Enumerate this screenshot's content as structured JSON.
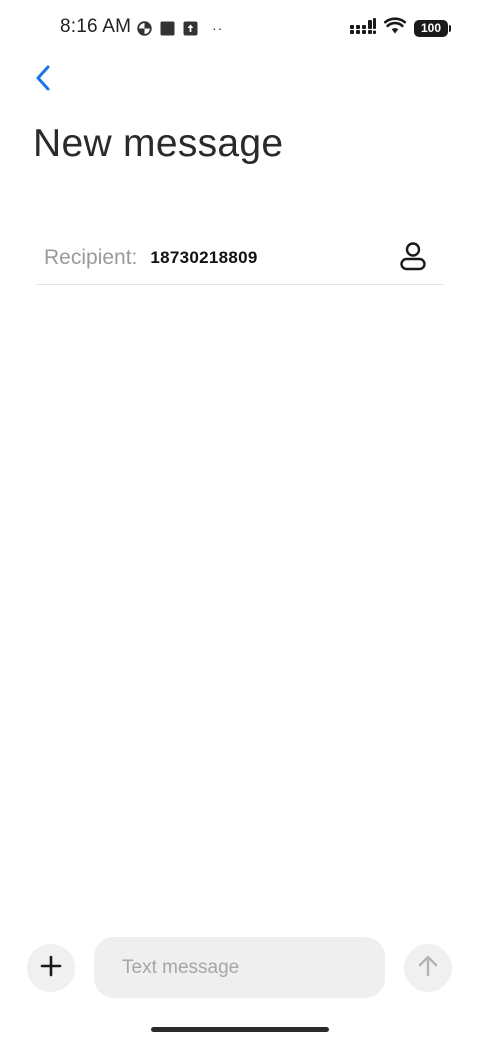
{
  "status_bar": {
    "time": "8:16 AM",
    "left_icons": [
      "data-saver-icon",
      "square-notification-icon",
      "upload-notification-icon"
    ],
    "more_dots": "··",
    "battery_level": "100",
    "right_icons": [
      "cellular-signal-icon",
      "wifi-icon",
      "battery-icon"
    ]
  },
  "header": {
    "back_icon": "chevron-left-icon",
    "title": "New message"
  },
  "recipient": {
    "label": "Recipient:",
    "value": "18730218809",
    "contact_icon": "person-icon"
  },
  "composer": {
    "add_icon": "plus-icon",
    "placeholder": "Text message",
    "value": "",
    "send_icon": "arrow-up-icon"
  },
  "colors": {
    "accent": "#1a73e8",
    "placeholder": "#a6a6a6",
    "input_background": "#efefef",
    "divider": "#e2e2e2"
  }
}
